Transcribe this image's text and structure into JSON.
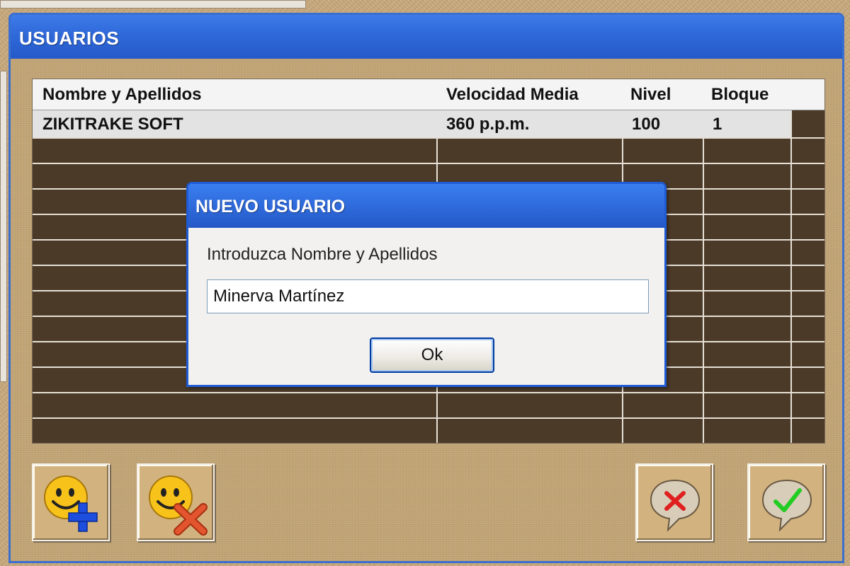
{
  "window": {
    "title": "USUARIOS"
  },
  "grid": {
    "columns": [
      "Nombre y Apellidos",
      "Velocidad Media",
      "Nivel",
      "Bloque"
    ],
    "rows": [
      {
        "name": "ZIKITRAKE SOFT",
        "speed": "360 p.p.m.",
        "level": "100",
        "block": "1"
      }
    ]
  },
  "dialog": {
    "title": "NUEVO USUARIO",
    "prompt": "Introduzca Nombre y Apellidos",
    "input_value": "Minerva Martínez",
    "ok_label": "Ok"
  },
  "toolbar": {
    "add_user_icon": "smiley-plus-icon",
    "delete_user_icon": "smiley-x-icon",
    "cancel_icon": "speech-bubble-x-icon",
    "accept_icon": "speech-bubble-check-icon"
  },
  "colors": {
    "titlebar": "#2f69da",
    "grid_background": "#4b3a28",
    "panel_background": "#c2a577",
    "add_accent": "#1e4ee0",
    "delete_accent": "#e2552f",
    "check_accent": "#22cc22"
  }
}
